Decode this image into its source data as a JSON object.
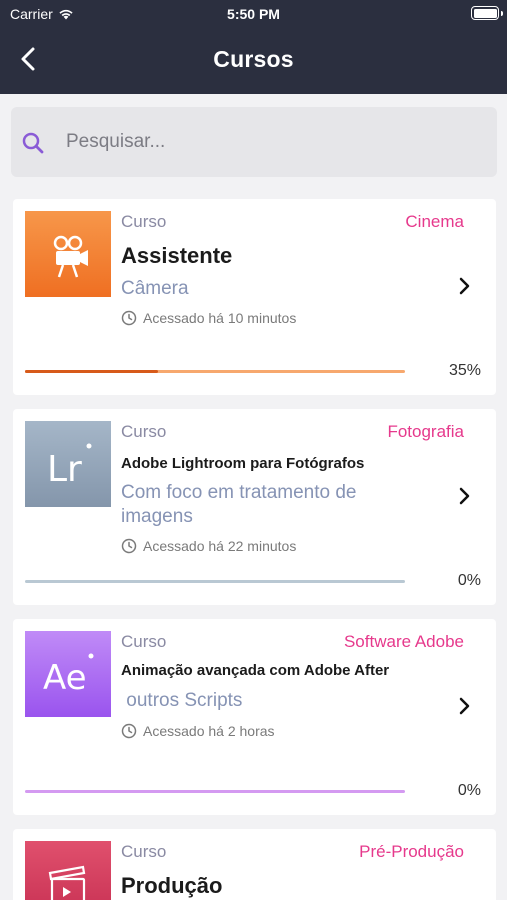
{
  "status_bar": {
    "carrier": "Carrier",
    "time": "5:50 PM"
  },
  "header": {
    "title": "Cursos"
  },
  "search": {
    "placeholder": "Pesquisar..."
  },
  "courses": [
    {
      "label": "Curso",
      "category": "Cinema",
      "title": "Assistente",
      "subtitle": "Câmera",
      "accessed": "Acessado há 10 minutos",
      "progress_text": "35%",
      "progress": 0.35,
      "thumb_icon": "film-camera-icon",
      "thumb_color": "#f47d2e",
      "bar_color": "#f7a86e",
      "fill_color": "#d75a1a"
    },
    {
      "label": "Curso",
      "category": "Fotografia",
      "title": "Adobe Lightroom para Fotógrafos",
      "subtitle": "Com foco em tratamento de imagens",
      "accessed": "Acessado há 22 minutos",
      "progress_text": "0%",
      "progress": 0,
      "thumb_text": "Lr",
      "thumb_color": "#8fa1b6",
      "bar_color": "#b9c8d3",
      "fill_color": "#8fa1b6"
    },
    {
      "label": "Curso",
      "category": "Software Adobe",
      "title": "Animação avançada com Adobe After",
      "subtitle": " outros Scripts",
      "accessed": "Acessado há 2 horas",
      "progress_text": "0%",
      "progress": 0,
      "thumb_text": "Ae",
      "thumb_color": "#a15cf0",
      "bar_color": "#d49af1",
      "fill_color": "#a15cf0"
    },
    {
      "label": "Curso",
      "category": "Pré-Produção",
      "title": "Produção",
      "thumb_icon": "clapperboard-icon",
      "thumb_color": "#d0385b"
    }
  ]
}
